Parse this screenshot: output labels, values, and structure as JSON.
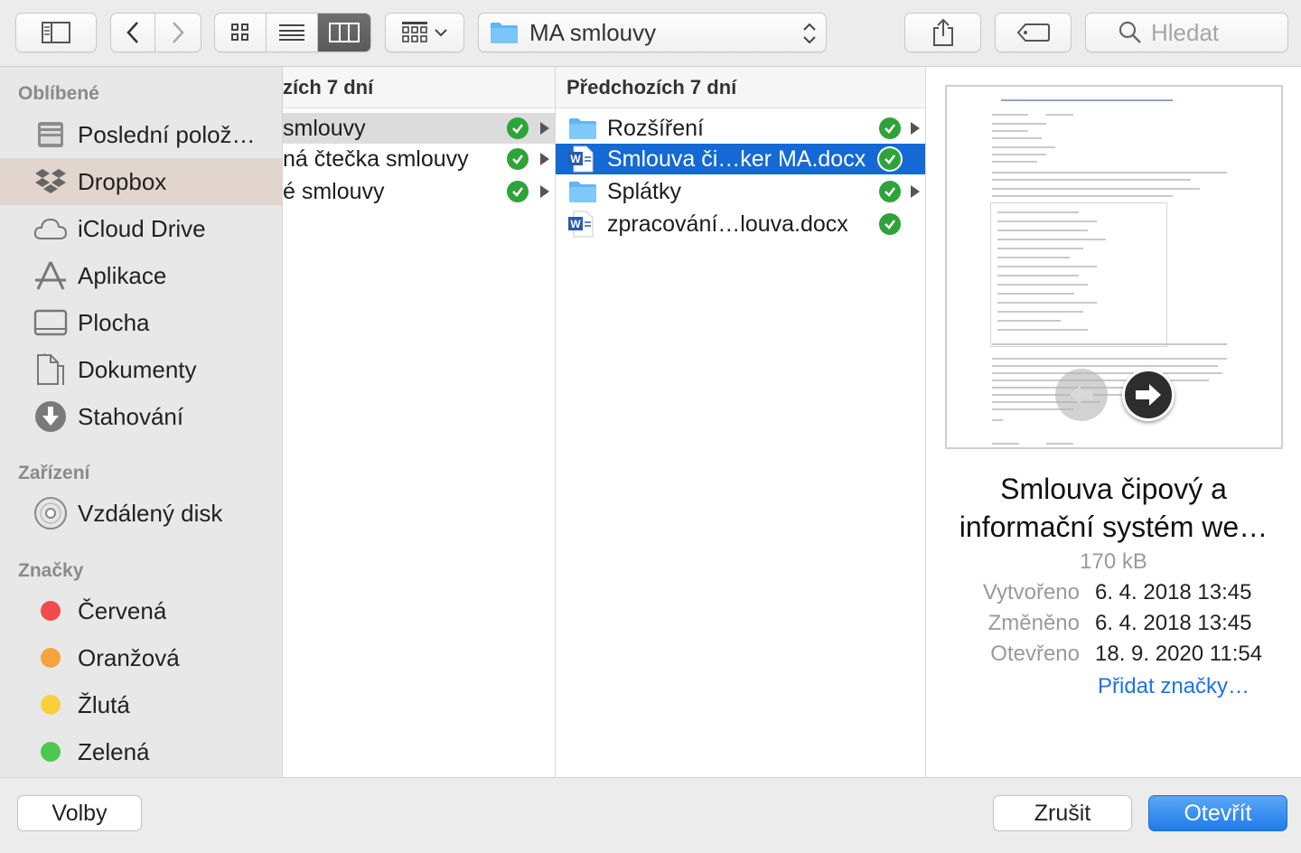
{
  "toolbar": {
    "path_label": "MA smlouvy",
    "search_placeholder": "Hledat"
  },
  "sidebar": {
    "sections": {
      "favorites": "Oblíbené",
      "devices": "Zařízení",
      "tags": "Značky"
    },
    "favorites": [
      {
        "label": "Poslední polož…",
        "icon": "recents-icon"
      },
      {
        "label": "Dropbox",
        "icon": "dropbox-icon",
        "selected": true
      },
      {
        "label": "iCloud Drive",
        "icon": "cloud-icon"
      },
      {
        "label": "Aplikace",
        "icon": "applications-icon"
      },
      {
        "label": "Plocha",
        "icon": "desktop-icon"
      },
      {
        "label": "Dokumenty",
        "icon": "documents-icon"
      },
      {
        "label": "Stahování",
        "icon": "downloads-icon"
      }
    ],
    "devices": [
      {
        "label": "Vzdálený disk",
        "icon": "remote-disc-icon"
      }
    ],
    "tags": [
      {
        "label": "Červená",
        "color": "#f24b4b"
      },
      {
        "label": "Oranžová",
        "color": "#f5a33b"
      },
      {
        "label": "Žlutá",
        "color": "#f7d13c"
      },
      {
        "label": "Zelená",
        "color": "#4cc74f"
      }
    ]
  },
  "column1": {
    "header": "zích 7 dní",
    "rows": [
      {
        "label": "smlouvy",
        "selected": true
      },
      {
        "label": "ná čtečka smlouvy"
      },
      {
        "label": "é smlouvy"
      }
    ]
  },
  "column2": {
    "header": "Předchozích 7 dní",
    "rows": [
      {
        "label": "Rozšíření",
        "type": "folder"
      },
      {
        "label": "Smlouva či…ker MA.docx",
        "type": "word",
        "selected": true
      },
      {
        "label": "Splátky",
        "type": "folder"
      },
      {
        "label": "zpracování…louva.docx",
        "type": "word"
      }
    ]
  },
  "preview": {
    "title_line1": "Smlouva čipový a",
    "title_line2": "informační systém we…",
    "size": "170 kB",
    "meta": [
      {
        "label": "Vytvořeno",
        "value": "6. 4. 2018 13:45"
      },
      {
        "label": "Změněno",
        "value": "6. 4. 2018 13:45"
      },
      {
        "label": "Otevřeno",
        "value": "18. 9. 2020 11:54"
      }
    ],
    "add_tags": "Přidat značky…"
  },
  "buttons": {
    "options": "Volby",
    "cancel": "Zrušit",
    "open": "Otevřít"
  },
  "colors": {
    "selection_blue": "#1469d5",
    "sync_green": "#2ea33a",
    "primary_button": "#1f7bea"
  }
}
